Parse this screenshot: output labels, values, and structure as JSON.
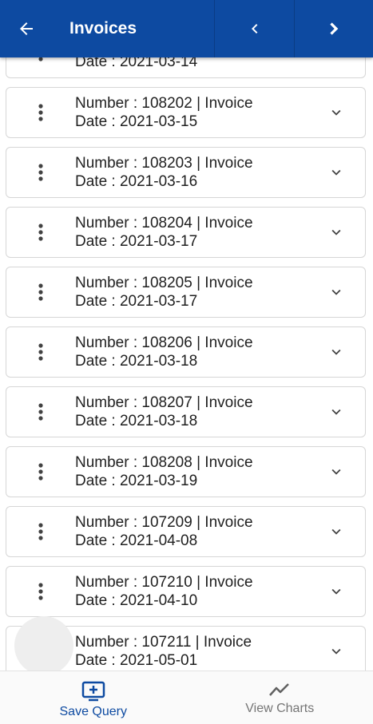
{
  "colors": {
    "primary": "#0d4aa1",
    "inactive": "#757575"
  },
  "app_bar": {
    "title": "Invoices",
    "back_icon": "arrow-left-icon",
    "prev_icon": "chevron-left-icon",
    "next_icon": "chevron-right-icon"
  },
  "invoices": [
    {
      "line1": "",
      "line2": "Date  : 2021-03-14"
    },
    {
      "line1": "Number  : 108202 | Invoice",
      "line2": "Date  : 2021-03-15"
    },
    {
      "line1": "Number  : 108203 | Invoice",
      "line2": "Date  : 2021-03-16"
    },
    {
      "line1": "Number  : 108204 | Invoice",
      "line2": "Date  : 2021-03-17"
    },
    {
      "line1": "Number  : 108205 | Invoice",
      "line2": "Date  : 2021-03-17"
    },
    {
      "line1": "Number  : 108206 | Invoice",
      "line2": "Date  : 2021-03-18"
    },
    {
      "line1": "Number  : 108207 | Invoice",
      "line2": "Date  : 2021-03-18"
    },
    {
      "line1": "Number  : 108208 | Invoice",
      "line2": "Date  : 2021-03-19"
    },
    {
      "line1": "Number  : 107209 | Invoice",
      "line2": "Date  : 2021-04-08"
    },
    {
      "line1": "Number  : 107210 | Invoice",
      "line2": "Date  : 2021-04-10"
    },
    {
      "line1": "Number  : 107211 | Invoice",
      "line2": "Date  : 2021-05-01"
    }
  ],
  "bottom_nav": {
    "save_query": {
      "label": "Save Query",
      "icon": "add-to-screen-icon",
      "active": true
    },
    "view_charts": {
      "label": "View Charts",
      "icon": "line-chart-icon",
      "active": false
    }
  }
}
